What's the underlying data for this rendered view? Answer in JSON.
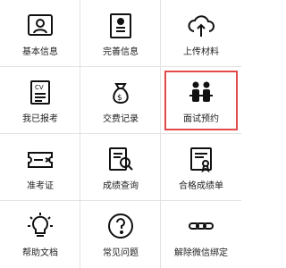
{
  "menu": {
    "items": [
      {
        "label": "基本信息",
        "icon": "id-card-icon"
      },
      {
        "label": "完善信息",
        "icon": "profile-card-icon"
      },
      {
        "label": "上传材料",
        "icon": "cloud-upload-icon"
      },
      {
        "label": "我已报考",
        "icon": "cv-document-icon"
      },
      {
        "label": "交费记录",
        "icon": "money-bag-icon"
      },
      {
        "label": "面试预约",
        "icon": "interview-people-icon"
      },
      {
        "label": "准考证",
        "icon": "ticket-icon"
      },
      {
        "label": "成绩查询",
        "icon": "search-document-icon"
      },
      {
        "label": "合格成绩单",
        "icon": "certificate-icon"
      },
      {
        "label": "帮助文档",
        "icon": "lightbulb-icon"
      },
      {
        "label": "常见问题",
        "icon": "question-icon"
      },
      {
        "label": "解除微信绑定",
        "icon": "chain-link-icon"
      }
    ],
    "highlight_color": "#e24a4a"
  }
}
